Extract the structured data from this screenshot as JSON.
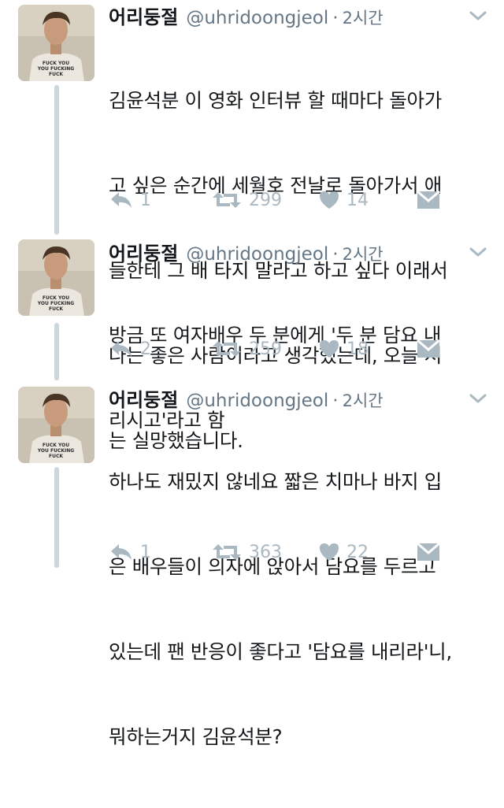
{
  "colors": {
    "text": "#14171a",
    "secondary": "#657786",
    "icon": "#aab8c2",
    "thread_line": "#ccd6dd",
    "background": "#ffffff"
  },
  "icons": {
    "reply": "reply-icon",
    "retweet": "retweet-icon",
    "like": "heart-icon",
    "dm": "envelope-icon",
    "more": "chevron-down-icon"
  },
  "tweets": [
    {
      "display_name": "어리둥절",
      "handle": "@uhridoongjeol",
      "separator": "·",
      "time": "2시간",
      "lines": [
        "김윤석분 이 영화 인터뷰 할 때마다 돌아가",
        "고 싶은 순간에 세월호 전날로 돌아가서 애",
        "들한테 그 배 타지 말라고 하고 싶다 이래서",
        "나는 좋은 사람이라고 생각했는데, 오늘 저",
        "는 실망했습니다."
      ],
      "avatar_text": [
        "FUCK YOU",
        "YOU FUCKING",
        "FUCK"
      ],
      "replies": "1",
      "retweets": "299",
      "likes": "14"
    },
    {
      "display_name": "어리둥절",
      "handle": "@uhridoongjeol",
      "separator": "·",
      "time": "2시간",
      "lines": [
        "방금 또 여자배우 두 분에게 '두 분 담요 내",
        "리시고'라고 함"
      ],
      "avatar_text": [
        "FUCK YOU",
        "YOU FUCKING",
        "FUCK"
      ],
      "replies": "2",
      "retweets": "259",
      "likes": "18"
    },
    {
      "display_name": "어리둥절",
      "handle": "@uhridoongjeol",
      "separator": "·",
      "time": "2시간",
      "lines": [
        "하나도 재밌지 않네요 짧은 치마나 바지 입",
        "은 배우들이 의자에 앉아서 담요를 두르고",
        "있는데 팬 반응이 좋다고 '담요를 내리라'니,",
        "뭐하는거지 김윤석분?"
      ],
      "avatar_text": [
        "FUCK YOU",
        "YOU FUCKING",
        "FUCK"
      ],
      "replies": "1",
      "retweets": "363",
      "likes": "22"
    }
  ]
}
